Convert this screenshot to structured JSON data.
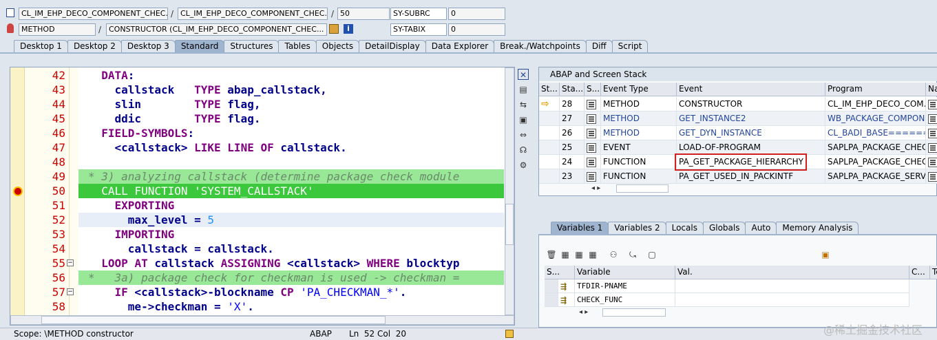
{
  "top_fields": {
    "row1": {
      "program": "CL_IM_EHP_DECO_COMPONENT_CHEC...",
      "include": "CL_IM_EHP_DECO_COMPONENT_CHEC...",
      "line": "50",
      "var_name": "SY-SUBRC",
      "var_value": "0"
    },
    "row2": {
      "type": "METHOD",
      "name": "CONSTRUCTOR (CL_IM_EHP_DECO_COMPONENT_CHEC...",
      "var_name": "SY-TABIX",
      "var_value": "0"
    },
    "sep": "/"
  },
  "main_tabs": [
    "Desktop 1",
    "Desktop 2",
    "Desktop 3",
    "Standard",
    "Structures",
    "Tables",
    "Objects",
    "DetailDisplay",
    "Data Explorer",
    "Break./Watchpoints",
    "Diff",
    "Script"
  ],
  "active_main_tab": "Standard",
  "code": [
    {
      "n": "42",
      "text": "  DATA:"
    },
    {
      "n": "43",
      "text": "    callstack   TYPE abap_callstack,"
    },
    {
      "n": "44",
      "text": "    slin        TYPE flag,"
    },
    {
      "n": "45",
      "text": "    ddic        TYPE flag."
    },
    {
      "n": "46",
      "text": "  FIELD-SYMBOLS:"
    },
    {
      "n": "47",
      "text": "    <callstack> LIKE LINE OF callstack."
    },
    {
      "n": "48",
      "text": ""
    },
    {
      "n": "49",
      "text": "* 3) analyzing callstack (determine package check module"
    },
    {
      "n": "50",
      "text": "  CALL FUNCTION 'SYSTEM_CALLSTACK'"
    },
    {
      "n": "51",
      "text": "    EXPORTING"
    },
    {
      "n": "52",
      "text": "      max_level = 5"
    },
    {
      "n": "53",
      "text": "    IMPORTING"
    },
    {
      "n": "54",
      "text": "      callstack = callstack."
    },
    {
      "n": "55",
      "text": "  LOOP AT callstack ASSIGNING <callstack> WHERE blocktyp"
    },
    {
      "n": "56",
      "text": "*   3a) package check for checkman is used -> checkman ="
    },
    {
      "n": "57",
      "text": "    IF <callstack>-blockname CP 'PA_CHECKMAN_*'."
    },
    {
      "n": "58",
      "text": "      me->checkman = 'X'."
    }
  ],
  "stack_panel": {
    "title": "ABAP and Screen Stack",
    "columns": [
      "St...",
      "Sta...",
      "S...",
      "Event Type",
      "Event",
      "Program",
      "Na"
    ],
    "rows": [
      {
        "level": "28",
        "type": "METHOD",
        "event": "CONSTRUCTOR",
        "program": "CL_IM_EHP_DECO_COM...",
        "current": true,
        "link": false
      },
      {
        "level": "27",
        "type": "METHOD",
        "event": "GET_INSTANCE2",
        "program": "WB_PACKAGE_COMPON...",
        "current": false,
        "link": true
      },
      {
        "level": "26",
        "type": "METHOD",
        "event": "GET_DYN_INSTANCE",
        "program": "CL_BADI_BASE=======...",
        "current": false,
        "link": true
      },
      {
        "level": "25",
        "type": "EVENT",
        "event": "LOAD-OF-PROGRAM",
        "program": "SAPLPA_PACKAGE_CHEC...",
        "current": false,
        "link": false
      },
      {
        "level": "24",
        "type": "FUNCTION",
        "event": "PA_GET_PACKAGE_HIERARCHY",
        "program": "SAPLPA_PACKAGE_CHEC...",
        "current": false,
        "link": false
      },
      {
        "level": "23",
        "type": "FUNCTION",
        "event": "PA_GET_USED_IN_PACKINTF",
        "program": "SAPLPA_PACKAGE_SERV...",
        "current": false,
        "link": false
      }
    ]
  },
  "var_tabs": [
    "Variables 1",
    "Variables 2",
    "Locals",
    "Globals",
    "Auto",
    "Memory Analysis"
  ],
  "active_var_tab": "Variables 1",
  "var_table": {
    "columns": [
      "S...",
      "Variable",
      "Val.",
      "C...",
      "Te"
    ],
    "rows": [
      {
        "name": "TFDIR-PNAME",
        "value": ""
      },
      {
        "name": "CHECK_FUNC",
        "value": ""
      }
    ]
  },
  "status": {
    "scope": "Scope: \\METHOD constructor",
    "lang": "ABAP",
    "pos": "Ln  52 Col  20"
  },
  "watermark": "@稀土掘金技术社区",
  "colors": {
    "highlight_box": "#d02020",
    "breakpoint": "#cc0000",
    "current_line": "#3cc83c",
    "comment_line": "#98e898"
  }
}
